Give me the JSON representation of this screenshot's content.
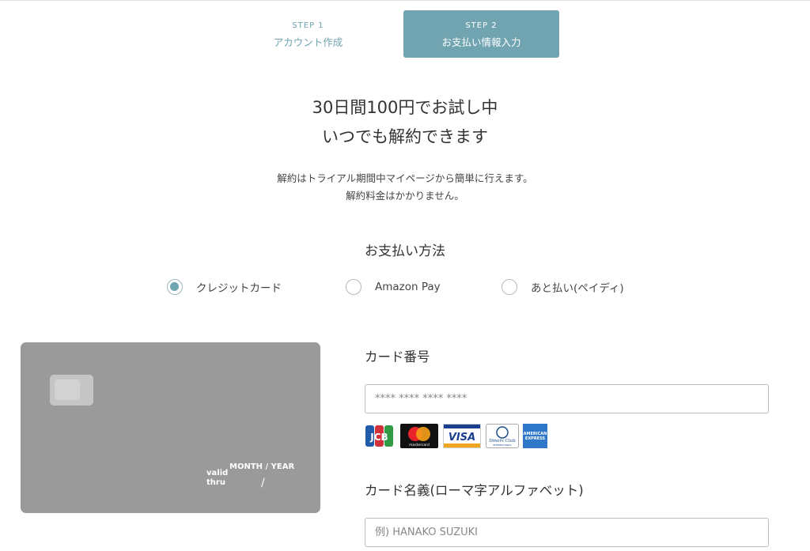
{
  "steps": [
    {
      "number": "STEP 1",
      "label": "アカウント作成",
      "active": false
    },
    {
      "number": "STEP 2",
      "label": "お支払い情報入力",
      "active": true
    }
  ],
  "headline": {
    "line1": "30日間100円でお試し中",
    "line2": "いつでも解約できます"
  },
  "subtext": {
    "line1": "解約はトライアル期間中マイページから簡単に行えます。",
    "line2": "解約料金はかかりません。"
  },
  "payment": {
    "title": "お支払い方法",
    "options": [
      {
        "label": "クレジットカード",
        "selected": true
      },
      {
        "label": "Amazon Pay",
        "selected": false
      },
      {
        "label": "あと払い(ペイディ)",
        "selected": false
      }
    ]
  },
  "card_preview": {
    "valid_line1": "valid",
    "valid_line2": "thru",
    "expiry_caption": "MONTH / YEAR",
    "expiry_separator": "/"
  },
  "form": {
    "card_number_label": "カード番号",
    "card_number_placeholder": "**** **** **** ****",
    "card_number_value": "",
    "card_name_label": "カード名義(ローマ字アルファベット)",
    "card_name_placeholder": "例) HANAKO SUZUKI",
    "card_name_value": ""
  },
  "brands": [
    {
      "icon": "jcb-logo",
      "text": "JCB"
    },
    {
      "icon": "mastercard-logo",
      "text": "mastercard"
    },
    {
      "icon": "visa-logo",
      "text": "VISA"
    },
    {
      "icon": "diners-club-logo",
      "text": "Diners Club",
      "text2": "INTERNATIONAL"
    },
    {
      "icon": "american-express-logo",
      "text": "AMERICAN",
      "text2": "EXPRESS"
    }
  ],
  "colors": {
    "accent": "#6fa4b0",
    "card_face": "#9a9a9a"
  }
}
